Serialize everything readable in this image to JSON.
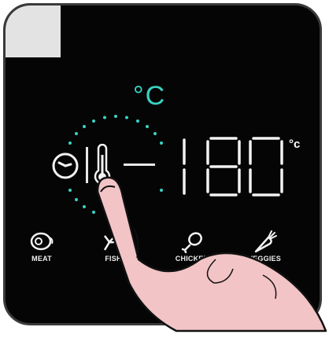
{
  "display": {
    "unit_top": "°C",
    "temperature": "180",
    "unit_small": "°c"
  },
  "presets": [
    {
      "label": "MEAT",
      "icon": "steak-icon"
    },
    {
      "label": "FISH",
      "icon": "fish-icon"
    },
    {
      "label": "CHICKEN",
      "icon": "chicken-leg-icon"
    },
    {
      "label": "VEGGIES",
      "icon": "carrot-icon"
    }
  ],
  "controls": {
    "timer_icon": "clock-icon",
    "temperature_icon": "thermometer-icon",
    "decrease_icon": "minus-icon"
  },
  "colors": {
    "accent": "#39d3c4",
    "panel": "#050505",
    "segment": "#f2f2f2",
    "hand": "#f2c4c6"
  }
}
